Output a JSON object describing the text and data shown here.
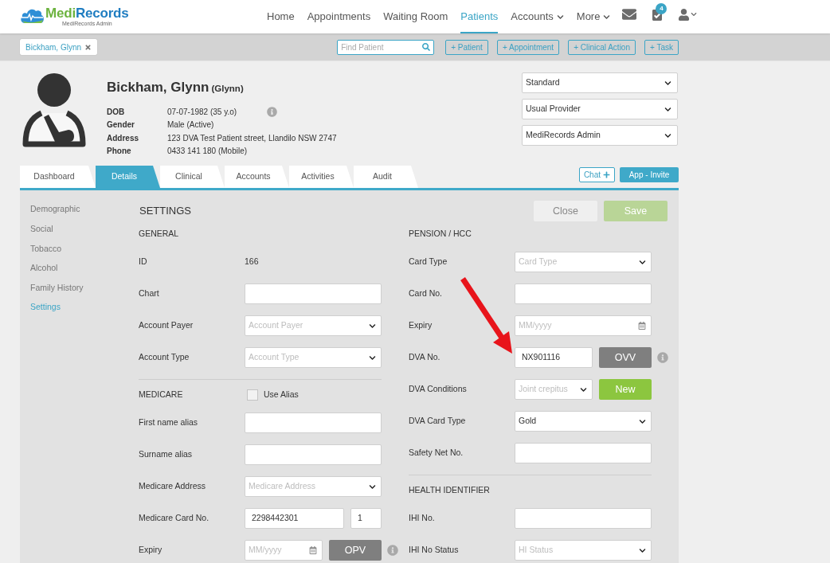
{
  "header": {
    "logo": {
      "parts": [
        "Medi",
        "Records"
      ],
      "subtitle": "MediRecords Admin"
    },
    "nav": [
      {
        "label": "Home",
        "kind": "link",
        "selected": false
      },
      {
        "label": "Appointments",
        "kind": "link",
        "selected": false
      },
      {
        "label": "Waiting Room",
        "kind": "link",
        "selected": false
      },
      {
        "label": "Patients",
        "kind": "link",
        "selected": true
      },
      {
        "label": "Accounts",
        "kind": "dropdown",
        "selected": false
      },
      {
        "label": "More",
        "kind": "dropdown",
        "selected": false
      }
    ],
    "tasks_badge": "4"
  },
  "toolbar": {
    "patient_tab": "Bickham, Glynn",
    "search": {
      "placeholder": "Find Patient"
    },
    "buttons": [
      "+ Patient",
      "+ Appointment",
      "+ Clinical Action",
      "+ Task"
    ]
  },
  "patient": {
    "name": "Bickham, Glynn",
    "preferred_name": "(Glynn)",
    "details": [
      {
        "label": "DOB",
        "value": "07-07-1982 (35 y.o)",
        "info": true
      },
      {
        "label": "Gender",
        "value": "Male (Active)",
        "info": false
      },
      {
        "label": "Address",
        "value": "123 DVA Test Patient street, Llandilo NSW 2747",
        "info": false
      },
      {
        "label": "Phone",
        "value": "0433 141 180 (Mobile)",
        "info": false
      }
    ],
    "selects": [
      "Standard",
      "Usual Provider",
      "MediRecords Admin"
    ]
  },
  "tabs": [
    {
      "label": "Dashboard",
      "selected": false
    },
    {
      "label": "Details",
      "selected": true
    },
    {
      "label": "Clinical",
      "selected": false
    },
    {
      "label": "Accounts",
      "selected": false
    },
    {
      "label": "Activities",
      "selected": false
    },
    {
      "label": "Audit",
      "selected": false
    }
  ],
  "tab_actions": {
    "chat": "Chat",
    "invite": "App - Invite"
  },
  "side_menu": [
    {
      "label": "Demographic",
      "selected": false
    },
    {
      "label": "Social",
      "selected": false
    },
    {
      "label": "Tobacco",
      "selected": false
    },
    {
      "label": "Alcohol",
      "selected": false
    },
    {
      "label": "Family History",
      "selected": false
    },
    {
      "label": "Settings",
      "selected": true
    }
  ],
  "settings": {
    "title": "SETTINGS",
    "close": "Close",
    "save": {
      "label": "Save",
      "disabled": true
    },
    "columns": [
      {
        "sections": [
          {
            "heading": "GENERAL",
            "rows": [
              {
                "label": "ID",
                "controls": [
                  {
                    "kind": "text",
                    "value": "166"
                  }
                ]
              },
              {
                "label": "Chart",
                "controls": [
                  {
                    "kind": "input"
                  }
                ]
              },
              {
                "label": "Account Payer",
                "controls": [
                  {
                    "kind": "select",
                    "placeholder": "Account Payer"
                  }
                ]
              },
              {
                "label": "Account Type",
                "controls": [
                  {
                    "kind": "select",
                    "placeholder": "Account Type"
                  }
                ]
              }
            ]
          },
          {
            "heading": "MEDICARE",
            "option": {
              "label": "Use Alias",
              "checked": false
            },
            "rows": [
              {
                "label": "First name alias",
                "controls": [
                  {
                    "kind": "input"
                  }
                ]
              },
              {
                "label": "Surname alias",
                "controls": [
                  {
                    "kind": "input"
                  }
                ]
              },
              {
                "label": "Medicare Address",
                "controls": [
                  {
                    "kind": "select",
                    "placeholder": "Medicare Address"
                  }
                ]
              },
              {
                "label": "Medicare Card No.",
                "controls": [
                  {
                    "kind": "input",
                    "value": "2298442301"
                  },
                  {
                    "kind": "input",
                    "value": "1"
                  }
                ]
              },
              {
                "label": "Expiry",
                "controls": [
                  {
                    "kind": "date",
                    "placeholder": "MM/yyyy"
                  },
                  {
                    "kind": "button",
                    "label": "OPV",
                    "color": "#7f7f7f"
                  },
                  {
                    "kind": "info"
                  }
                ]
              }
            ]
          }
        ]
      },
      {
        "sections": [
          {
            "heading": "PENSION / HCC",
            "rows": [
              {
                "label": "Card Type",
                "controls": [
                  {
                    "kind": "select",
                    "placeholder": "Card Type"
                  }
                ]
              },
              {
                "label": "Card No.",
                "controls": [
                  {
                    "kind": "input"
                  }
                ]
              },
              {
                "label": "Expiry",
                "controls": [
                  {
                    "kind": "date",
                    "placeholder": "MM/yyyy"
                  }
                ]
              },
              {
                "label": "DVA No.",
                "controls": [
                  {
                    "kind": "input",
                    "value": "NX901116"
                  },
                  {
                    "kind": "button",
                    "label": "OVV",
                    "color": "#7f7f7f"
                  },
                  {
                    "kind": "info"
                  }
                ]
              },
              {
                "label": "DVA Conditions",
                "controls": [
                  {
                    "kind": "select",
                    "placeholder": "Joint crepitus"
                  },
                  {
                    "kind": "button",
                    "label": "New",
                    "color": "#8cc63f"
                  }
                ]
              },
              {
                "label": "DVA Card Type",
                "controls": [
                  {
                    "kind": "select",
                    "value": "Gold"
                  }
                ]
              },
              {
                "label": "Safety Net No.",
                "controls": [
                  {
                    "kind": "input"
                  }
                ]
              }
            ]
          },
          {
            "heading": "HEALTH IDENTIFIER",
            "rows": [
              {
                "label": "IHI No.",
                "controls": [
                  {
                    "kind": "input"
                  }
                ]
              },
              {
                "label": "IHI No Status",
                "controls": [
                  {
                    "kind": "select",
                    "placeholder": "HI Status"
                  }
                ]
              }
            ]
          }
        ]
      }
    ]
  }
}
